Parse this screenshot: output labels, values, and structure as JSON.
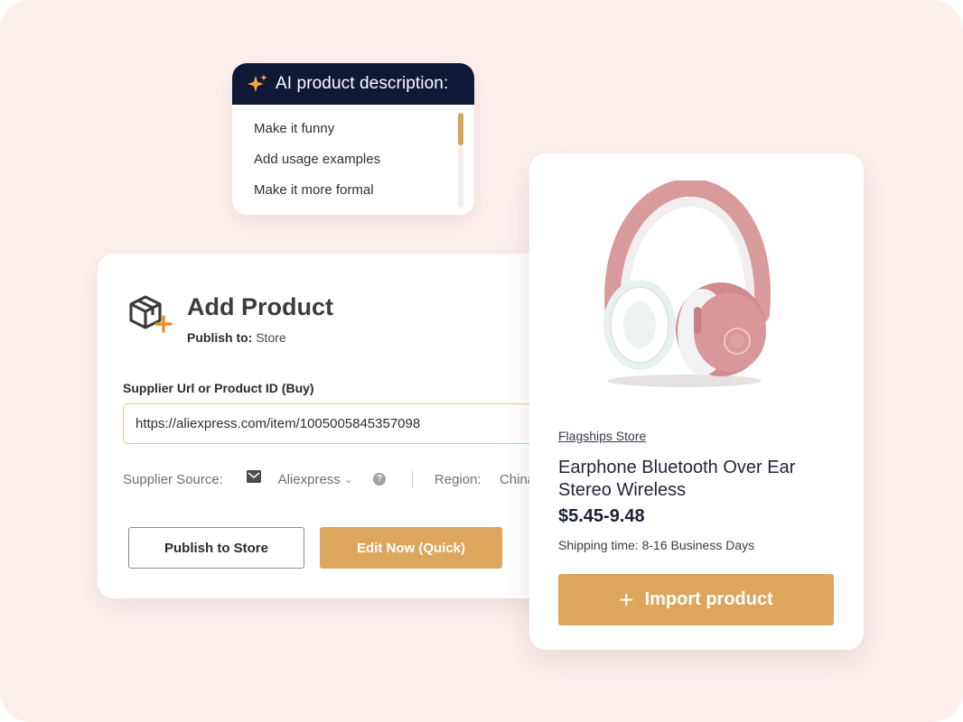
{
  "ai_popup": {
    "title": "AI product description:",
    "icon": "sparkle-icon",
    "options": [
      "Make it funny",
      "Add usage examples",
      "Make it more formal"
    ]
  },
  "add_product": {
    "title": "Add Product",
    "publish_to_label": "Publish to:",
    "publish_to_value": "Store",
    "field_label": "Supplier Url or Product ID (Buy)",
    "url_value": "https://aliexpress.com/item/1005005845357098",
    "supplier_source_label": "Supplier Source:",
    "supplier_source_value": "Aliexpress",
    "region_label": "Region:",
    "region_value": "China",
    "publish_button": "Publish to Store",
    "edit_button": "Edit Now (Quick)"
  },
  "product": {
    "store": "Flagships Store",
    "name": "Earphone Bluetooth Over Ear Stereo Wireless",
    "price": "$5.45-9.48",
    "shipping": "Shipping time: 8-16 Business Days",
    "import_button": "Import product"
  },
  "colors": {
    "accent": "#dca65c",
    "navy": "#0f1836",
    "background": "#fcf0ed"
  }
}
